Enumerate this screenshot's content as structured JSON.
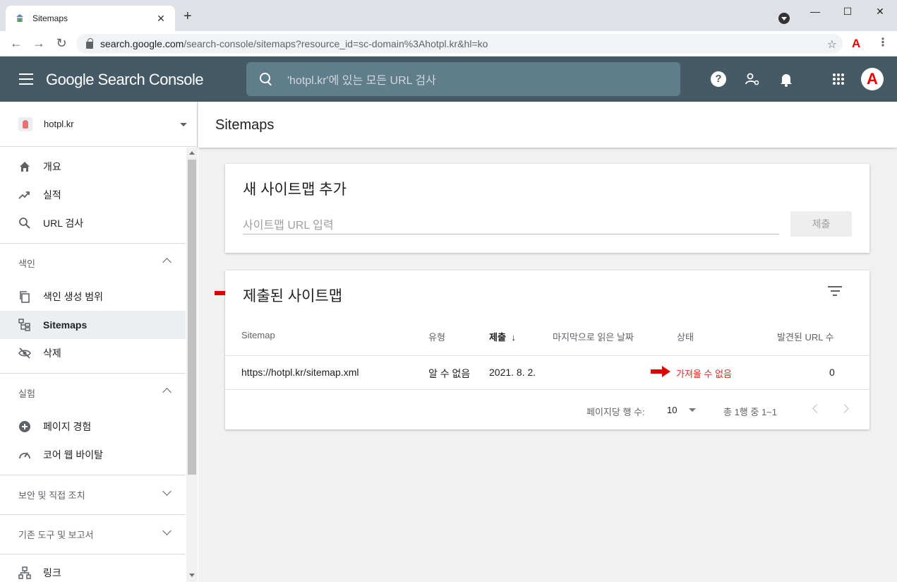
{
  "browser": {
    "tab_title": "Sitemaps",
    "tab_close": "✕",
    "new_tab": "+",
    "window_controls": {
      "minimize": "—",
      "maximize": "☐",
      "close": "✕"
    },
    "nav": {
      "back": "←",
      "forward": "→",
      "reload": "↻"
    },
    "url_host": "search.google.com",
    "url_path": "/search-console/sitemaps?resource_id=sc-domain%3Ahotpl.kr&hl=ko",
    "star": "☆",
    "extension_label": "A",
    "menu": "⋮"
  },
  "header": {
    "brand": "Google Search Console",
    "search_placeholder": "'hotpl.kr'에 있는 모든 URL 검사",
    "help": "?",
    "manage_users_icon": "person-gear-icon",
    "notifications_icon": "bell-icon",
    "apps_icon": "grid-icon",
    "avatar_label": "A",
    "bg_color": "#455a64"
  },
  "sidebar": {
    "property": "hotpl.kr",
    "items_top": [
      {
        "label": "개요",
        "icon": "home-icon"
      },
      {
        "label": "실적",
        "icon": "trending-icon"
      },
      {
        "label": "URL 검사",
        "icon": "search-icon"
      }
    ],
    "sections": [
      {
        "title": "색인",
        "expanded": true,
        "items": [
          {
            "label": "색인 생성 범위",
            "icon": "copy-icon",
            "active": false
          },
          {
            "label": "Sitemaps",
            "icon": "sitemap-icon",
            "active": true
          },
          {
            "label": "삭제",
            "icon": "eye-off-icon",
            "active": false
          }
        ]
      },
      {
        "title": "실험",
        "expanded": true,
        "items": [
          {
            "label": "페이지 경험",
            "icon": "plus-circle-icon"
          },
          {
            "label": "코어 웹 바이탈",
            "icon": "speedometer-icon"
          }
        ]
      },
      {
        "title": "보안 및 직접 조치",
        "expanded": false
      },
      {
        "title": "기존 도구 및 보고서",
        "expanded": false
      }
    ],
    "bottom_item": {
      "label": "링크",
      "icon": "network-icon"
    }
  },
  "main": {
    "page_title": "Sitemaps",
    "add_card": {
      "title": "새 사이트맵 추가",
      "input_placeholder": "사이트맵 URL 입력",
      "submit_label": "제출"
    },
    "submitted_card": {
      "title": "제출된 사이트맵",
      "columns": [
        "Sitemap",
        "유형",
        "제출",
        "마지막으로 읽은 날짜",
        "상태",
        "발견된 URL 수"
      ],
      "sort_arrow": "↓",
      "rows": [
        {
          "sitemap": "https://hotpl.kr/sitemap.xml",
          "type": "알 수 없음",
          "submitted": "2021. 8. 2.",
          "last_read": "",
          "status": "가져올 수 없음",
          "urls": "0"
        }
      ],
      "rows_per_page_label": "페이지당 행 수:",
      "rows_per_page": "10",
      "range_label": "총 1행 중 1~1"
    },
    "status_error_color": "#d93025",
    "arrow_color": "#e00000"
  }
}
